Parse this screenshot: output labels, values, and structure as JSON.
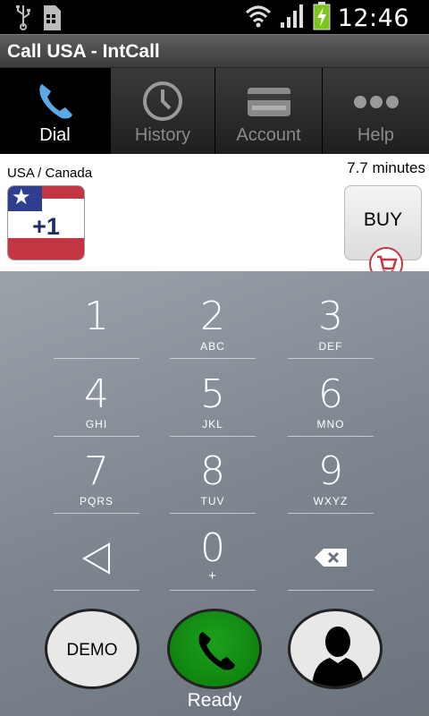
{
  "status_bar": {
    "time": "12:46",
    "icons": [
      "usb-icon",
      "sdcard-icon",
      "wifi-icon",
      "signal-icon",
      "battery-charging-icon"
    ]
  },
  "app": {
    "title": "Call USA - IntCall"
  },
  "tabs": [
    {
      "label": "Dial",
      "icon": "phone-icon",
      "active": true
    },
    {
      "label": "History",
      "icon": "clock-icon",
      "active": false
    },
    {
      "label": "Account",
      "icon": "card-icon",
      "active": false
    },
    {
      "label": "Help",
      "icon": "more-icon",
      "active": false
    }
  ],
  "country": {
    "name": "USA / Canada",
    "code": "+1",
    "minutes": "7.7 minutes",
    "buy_label": "BUY"
  },
  "dialpad": {
    "keys": [
      {
        "digit": "1",
        "letters": ""
      },
      {
        "digit": "2",
        "letters": "ABC"
      },
      {
        "digit": "3",
        "letters": "DEF"
      },
      {
        "digit": "4",
        "letters": "GHI"
      },
      {
        "digit": "5",
        "letters": "JKL"
      },
      {
        "digit": "6",
        "letters": "MNO"
      },
      {
        "digit": "7",
        "letters": "PQRS"
      },
      {
        "digit": "8",
        "letters": "TUV"
      },
      {
        "digit": "9",
        "letters": "WXYZ"
      },
      {
        "digit": "0",
        "letters": "+"
      }
    ]
  },
  "actions": {
    "demo_label": "DEMO",
    "status": "Ready"
  },
  "colors": {
    "call_green": "#0a8a0a",
    "flag_blue": "#2f3f8f",
    "flag_red": "#c43742"
  }
}
